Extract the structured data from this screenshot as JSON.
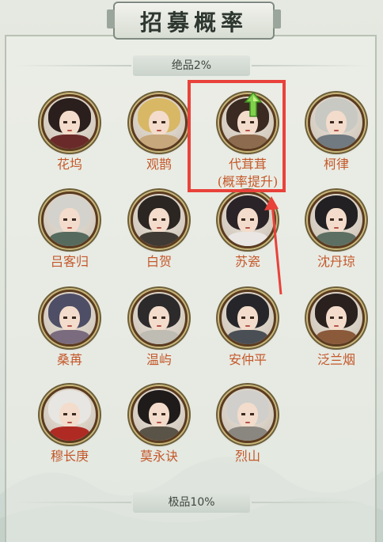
{
  "title": "招募概率",
  "tiers": [
    {
      "label": "绝品2%"
    },
    {
      "label": "极品10%"
    }
  ],
  "characters": [
    {
      "name": "花坞",
      "hair": "#2a1f1c",
      "clothes": "#6b2a2a"
    },
    {
      "name": "观鹊",
      "hair": "#d8b864",
      "clothes": "#c7a87c"
    },
    {
      "name": "代茸茸",
      "name2": "(概率提升)",
      "hair": "#3a2a22",
      "clothes": "#8c6b4e"
    },
    {
      "name": "柯律",
      "hair": "#c9c9c4",
      "clothes": "#707a80"
    },
    {
      "name": "吕客归",
      "hair": "#d4d2cc",
      "clothes": "#566b5e"
    },
    {
      "name": "白贺",
      "hair": "#2b2622",
      "clothes": "#3f3a33"
    },
    {
      "name": "苏瓷",
      "hair": "#2a2428",
      "clothes": "#e9e6e4"
    },
    {
      "name": "沈丹琼",
      "hair": "#222022",
      "clothes": "#5d6f63"
    },
    {
      "name": "桑苒",
      "hair": "#4e4e66",
      "clothes": "#7a6b7e"
    },
    {
      "name": "温屿",
      "hair": "#2c2a2a",
      "clothes": "#bfbcb4"
    },
    {
      "name": "安仲平",
      "hair": "#26262a",
      "clothes": "#4a4f55"
    },
    {
      "name": "泛兰烟",
      "hair": "#2a201e",
      "clothes": "#8a5a3a"
    },
    {
      "name": "穆长庚",
      "hair": "#e8e6e2",
      "clothes": "#b02a24"
    },
    {
      "name": "莫永诀",
      "hair": "#1f1b1a",
      "clothes": "#5a5348"
    },
    {
      "name": "烈山",
      "hair": "#d0cfcc",
      "clothes": "#8a8680"
    }
  ],
  "highlight_color": "#e8423a"
}
